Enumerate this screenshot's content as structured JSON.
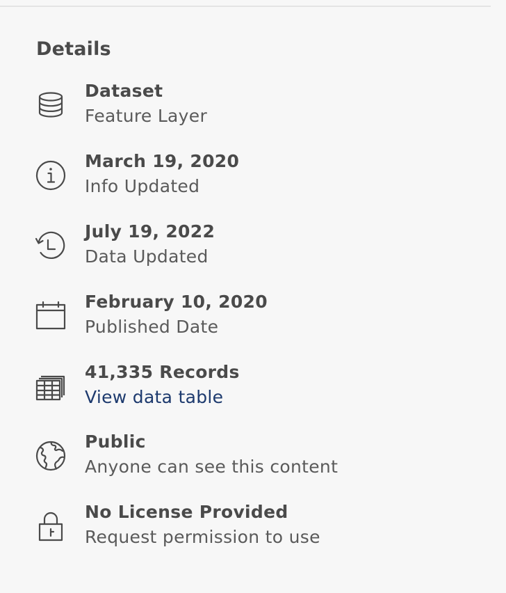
{
  "details": {
    "title": "Details",
    "items": [
      {
        "icon": "database-icon",
        "title": "Dataset",
        "subtitle": "Feature Layer"
      },
      {
        "icon": "info-icon",
        "title": "March 19, 2020",
        "subtitle": "Info Updated"
      },
      {
        "icon": "history-icon",
        "title": "July 19, 2022",
        "subtitle": "Data Updated"
      },
      {
        "icon": "calendar-icon",
        "title": "February 10, 2020",
        "subtitle": "Published Date"
      },
      {
        "icon": "table-icon",
        "title": "41,335 Records",
        "link": "View data table"
      },
      {
        "icon": "globe-icon",
        "title": "Public",
        "subtitle": "Anyone can see this content"
      },
      {
        "icon": "lock-icon",
        "title": "No License Provided",
        "subtitle": "Request permission to use"
      }
    ]
  },
  "colors": {
    "background": "#f7f7f7",
    "text": "#4a4a4a",
    "link": "#1d3a6e",
    "divider": "#e4e4e4"
  }
}
